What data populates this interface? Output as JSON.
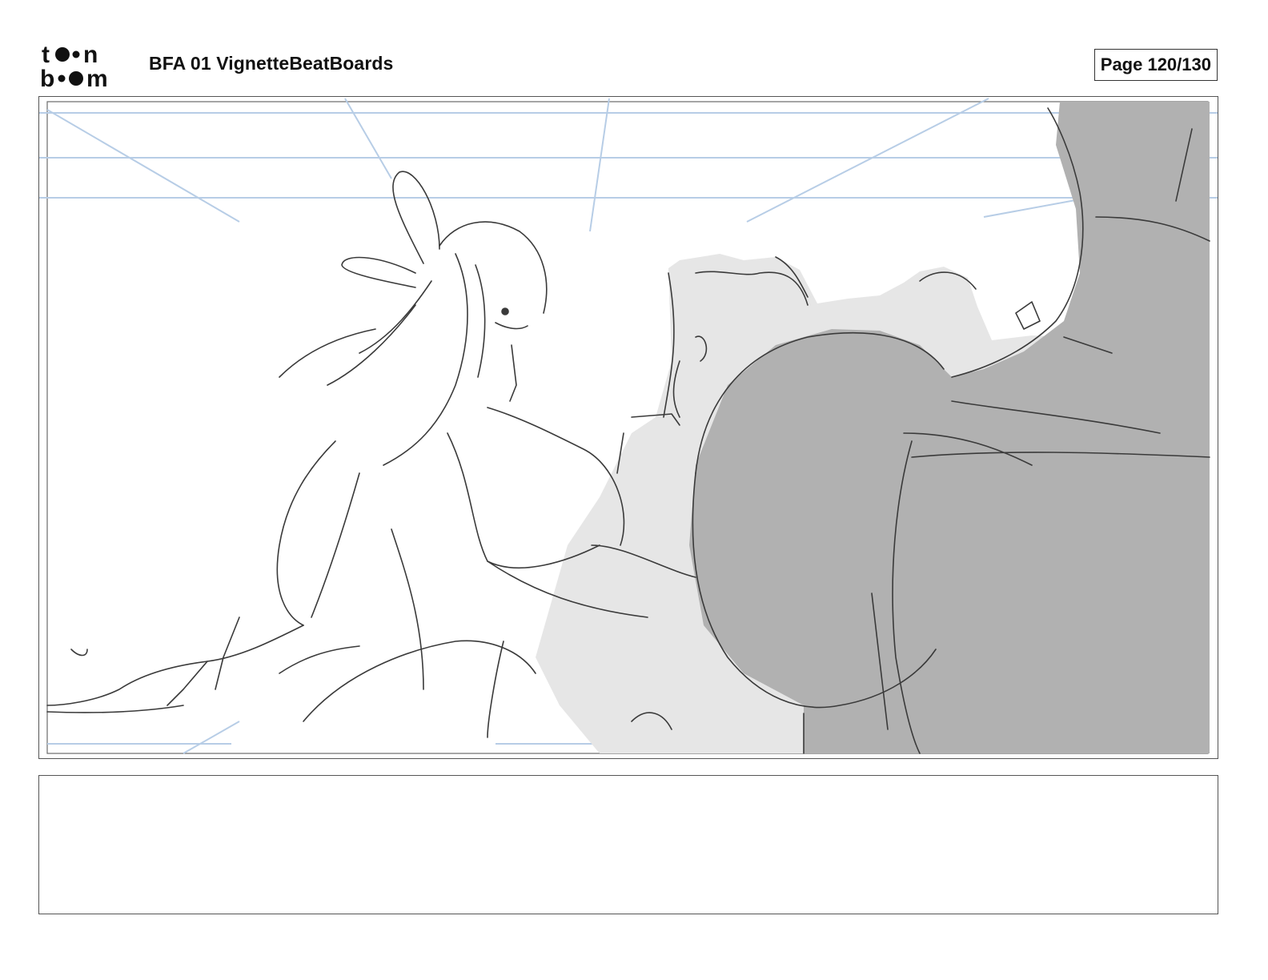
{
  "header": {
    "logo_text_top": "toon",
    "logo_text_bottom": "boom",
    "document_title": "BFA 01 VignetteBeatBoards",
    "page_label": "Page 120/130"
  },
  "panel": {
    "description_hidden": "storyboard sketch",
    "colors": {
      "guide_lines": "#b7cde6",
      "sketch_lines": "#3a3a3a",
      "light_fill": "#e6e6e6",
      "dark_fill": "#b1b1b1"
    }
  },
  "notes": {
    "text": ""
  }
}
